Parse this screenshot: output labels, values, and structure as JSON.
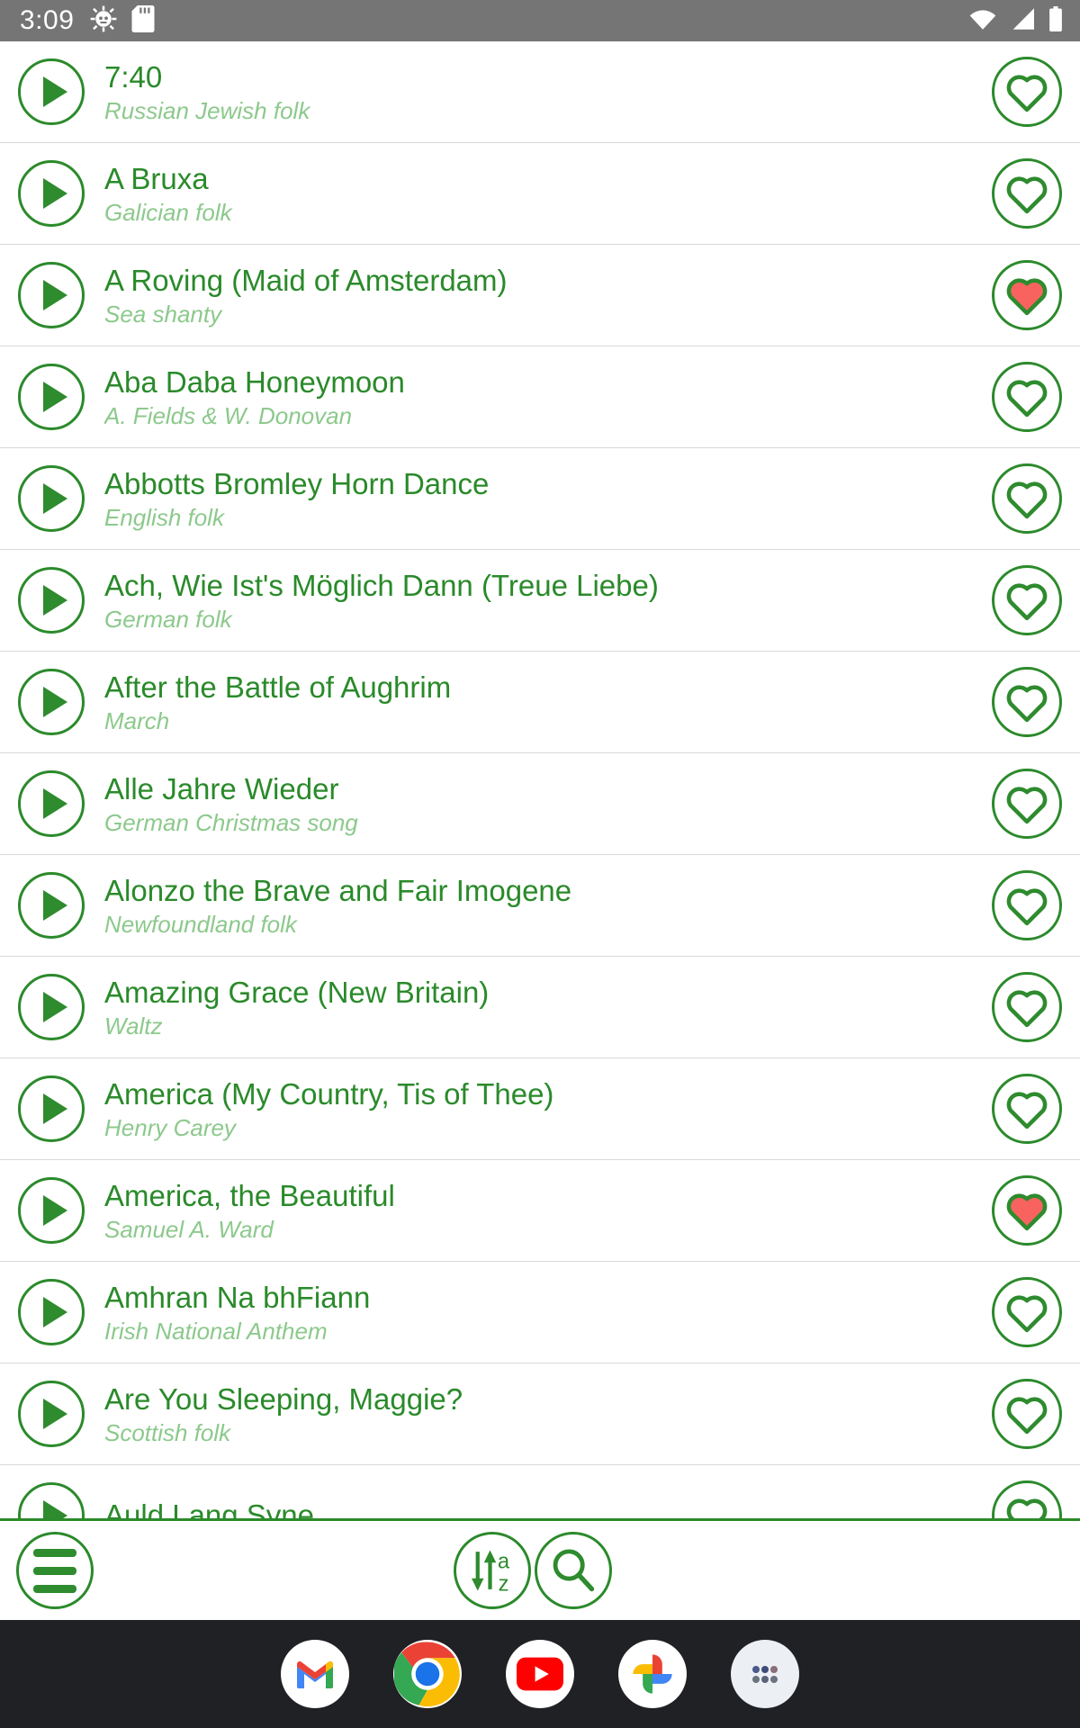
{
  "status_bar": {
    "time": "3:09",
    "left_icons": [
      "settings-gear-icon",
      "sd-card-icon"
    ],
    "right_icons": [
      "wifi-icon",
      "cell-signal-icon",
      "battery-icon"
    ],
    "background_color": "#757575",
    "foreground_color": "#ffffff"
  },
  "theme": {
    "accent_green": "#2e8b2e",
    "subtitle_green": "#8cc98c",
    "favorite_red": "#f8635f",
    "divider": "#d8d8d8",
    "dock_background": "#202124"
  },
  "song_list": {
    "items": [
      {
        "title": "7:40",
        "subtitle": "Russian Jewish folk",
        "favorite": false
      },
      {
        "title": "A Bruxa",
        "subtitle": "Galician folk",
        "favorite": false
      },
      {
        "title": "A Roving (Maid of Amsterdam)",
        "subtitle": "Sea shanty",
        "favorite": true
      },
      {
        "title": "Aba Daba Honeymoon",
        "subtitle": "A. Fields & W. Donovan",
        "favorite": false
      },
      {
        "title": "Abbotts Bromley Horn Dance",
        "subtitle": "English folk",
        "favorite": false
      },
      {
        "title": "Ach, Wie Ist's Möglich Dann (Treue Liebe)",
        "subtitle": "German folk",
        "favorite": false
      },
      {
        "title": "After the Battle of Aughrim",
        "subtitle": "March",
        "favorite": false
      },
      {
        "title": "Alle Jahre Wieder",
        "subtitle": "German Christmas song",
        "favorite": false
      },
      {
        "title": "Alonzo the Brave and Fair Imogene",
        "subtitle": "Newfoundland folk",
        "favorite": false
      },
      {
        "title": "Amazing Grace (New Britain)",
        "subtitle": "Waltz",
        "favorite": false
      },
      {
        "title": "America (My Country, Tis of Thee)",
        "subtitle": "Henry Carey",
        "favorite": false
      },
      {
        "title": "America, the Beautiful",
        "subtitle": "Samuel A. Ward",
        "favorite": true
      },
      {
        "title": "Amhran Na bhFiann",
        "subtitle": "Irish National Anthem",
        "favorite": false
      },
      {
        "title": "Are You Sleeping, Maggie?",
        "subtitle": "Scottish folk",
        "favorite": false
      },
      {
        "title": "Auld Lang Syne",
        "subtitle": "",
        "favorite": false
      }
    ]
  },
  "app_bar": {
    "menu_label": "menu-icon",
    "sort_label": "sort-a-z-icon",
    "sort_letters": {
      "top": "a",
      "bottom": "z"
    },
    "search_label": "search-icon"
  },
  "dock": {
    "apps": [
      "gmail-icon",
      "chrome-icon",
      "youtube-icon",
      "google-photos-icon",
      "app-drawer-icon"
    ]
  }
}
